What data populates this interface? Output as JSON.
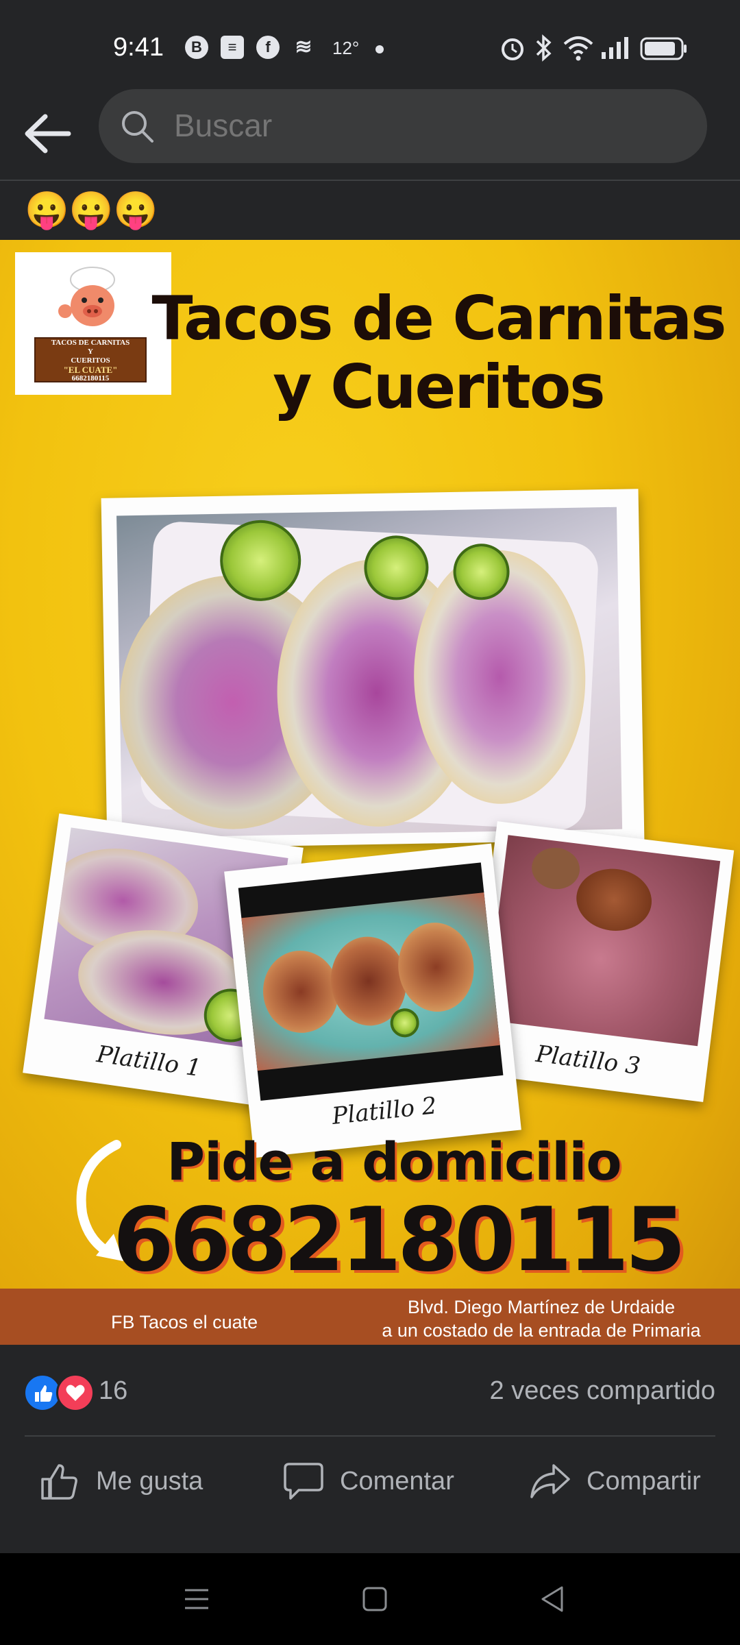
{
  "status_bar": {
    "time": "9:41",
    "temperature": "12°",
    "icons": [
      "b-circle-icon",
      "message-icon",
      "facebook-icon",
      "wind-icon",
      "alarm-icon",
      "bluetooth-icon",
      "wifi-icon",
      "signal-icon",
      "battery-icon"
    ]
  },
  "header": {
    "search_placeholder": "Buscar"
  },
  "post": {
    "emoji_text": "😛😛😛",
    "poster": {
      "logo_lines": [
        "TACOS DE CARNITAS",
        "Y",
        "CUERITOS",
        "\"EL CUATE\"",
        "6682180115"
      ],
      "title_line1": "Tacos de Carnitas",
      "title_line2": "y Cueritos",
      "photo_labels": [
        "Platillo 1",
        "Platillo 2",
        "Platillo 3"
      ],
      "cta": "Pide a domicilio",
      "phone": "6682180115",
      "footer_fb": "FB  Tacos el cuate",
      "footer_address_line1": "Blvd. Diego Martínez de Urdaide",
      "footer_address_line2": "a un costado de la entrada de Primaria"
    },
    "reactions": {
      "count": "16",
      "shares": "2 veces compartido"
    },
    "actions": {
      "like": "Me gusta",
      "comment": "Comentar",
      "share": "Compartir"
    }
  },
  "colors": {
    "background": "#242527",
    "poster_yellow": "#f2c20f",
    "footer_band": "#a74e22",
    "like_blue": "#1877f2",
    "love_red": "#f33e58"
  }
}
